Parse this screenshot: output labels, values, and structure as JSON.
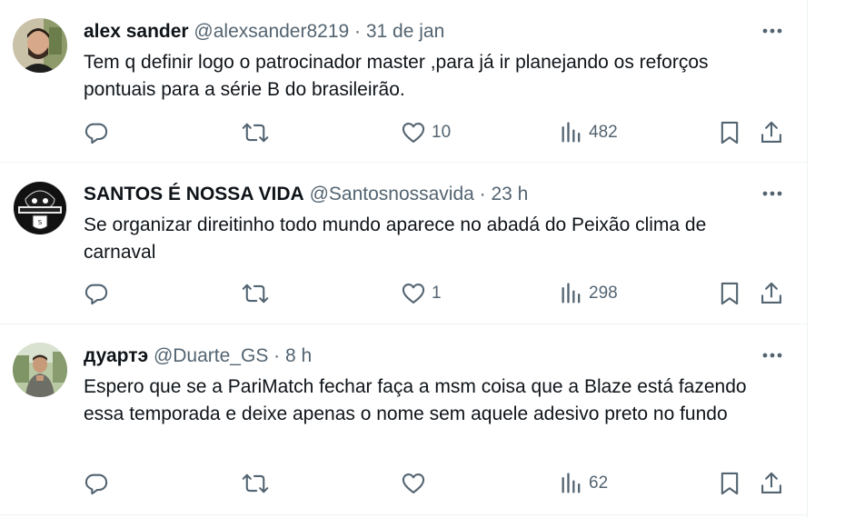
{
  "tweets": [
    {
      "name": "alex sander",
      "meta": "@alexsander8219 · 31 de jan",
      "text": "Tem q definir logo o patrocinador master ,para já ir planejando os reforços pontuais para a série B do brasileirão.",
      "likes": "10",
      "views": "482"
    },
    {
      "name": "SANTOS É NOSSA VIDA",
      "meta": "@Santosnossavida · 23 h",
      "text": "Se organizar direitinho todo mundo aparece no abadá do Peixão clima de carnaval",
      "likes": "1",
      "views": "298"
    },
    {
      "name": "дуартэ",
      "meta": "@Duarte_GS · 8 h",
      "text": "Espero que se a PariMatch fechar faça a msm coisa que a Blaze está fazendo essa temporada e deixe apenas o nome sem aquele adesivo preto no fundo",
      "likes": "",
      "views": "62"
    }
  ],
  "colors": {
    "text": "#0f1419",
    "secondary": "#536471",
    "divider": "#eff3f4"
  },
  "icons": {
    "reply": "reply-icon",
    "retweet": "retweet-icon",
    "like": "heart-icon",
    "views": "views-icon",
    "bookmark": "bookmark-icon",
    "share": "share-icon",
    "more": "more-icon"
  }
}
